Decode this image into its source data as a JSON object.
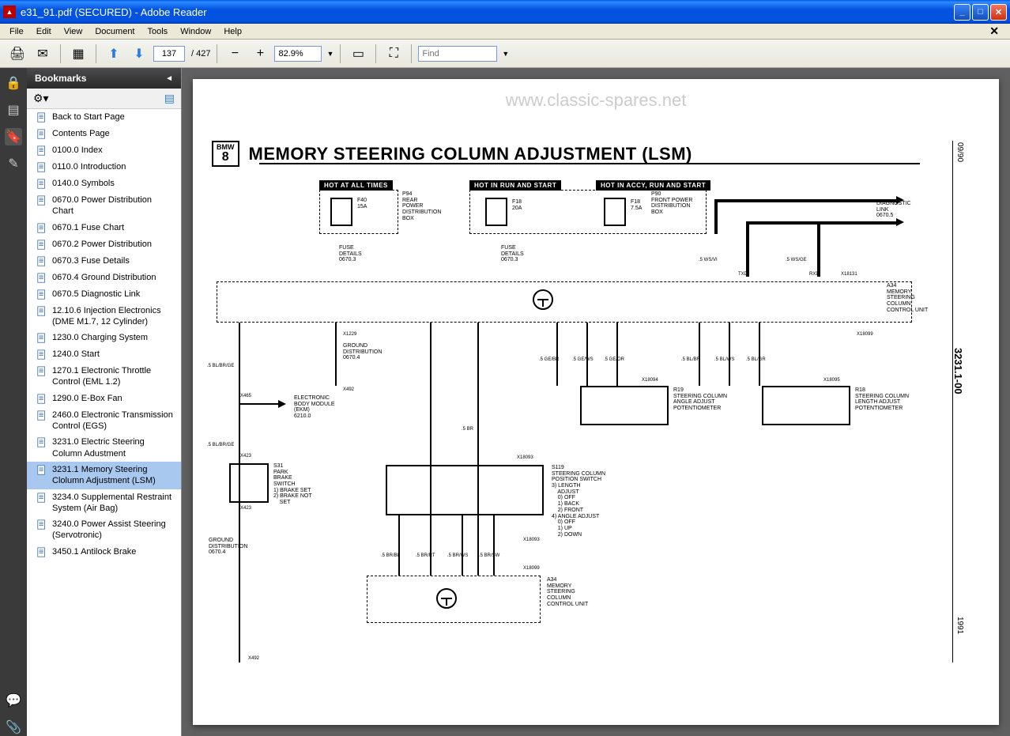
{
  "window": {
    "title": "e31_91.pdf (SECURED) - Adobe Reader"
  },
  "menu": {
    "file": "File",
    "edit": "Edit",
    "view": "View",
    "document": "Document",
    "tools": "Tools",
    "window": "Window",
    "help": "Help"
  },
  "toolbar": {
    "page_current": "137",
    "page_total": "/ 427",
    "zoom": "82.9%",
    "find_placeholder": "Find"
  },
  "bookmarks": {
    "title": "Bookmarks",
    "items": [
      "Back to Start Page",
      "Contents Page",
      "0100.0 Index",
      "0110.0 Introduction",
      "0140.0 Symbols",
      "0670.0 Power Distribution Chart",
      "0670.1 Fuse Chart",
      "0670.2 Power Distribution",
      "0670.3 Fuse Details",
      "0670.4 Ground Distribution",
      "0670.5 Diagnostic Link",
      "12.10.6 Injection Electronics (DME M1.7, 12 Cylinder)",
      "1230.0 Charging System",
      "1240.0 Start",
      "1270.1 Electronic Throttle Control (EML 1.2)",
      "1290.0 E-Box Fan",
      "2460.0 Electronic Transmission Control (EGS)",
      "3231.0 Electric Steering Column Adustment",
      "3231.1 Memory Steering Clolumn Adjustment (LSM)",
      "3234.0 Supplemental Restraint System (Air Bag)",
      "3240.0 Power Assist Steering (Servotronic)",
      "3450.1 Antilock Brake"
    ],
    "selected_index": 18
  },
  "diagram": {
    "watermark": "www.classic-spares.net",
    "badge_top": "BMW",
    "badge_num": "8",
    "title": "MEMORY STEERING COLUMN ADJUSTMENT (LSM)",
    "hot1": "HOT AT ALL TIMES",
    "hot2": "HOT IN RUN AND START",
    "hot3": "HOT IN ACCY, RUN AND START",
    "p94": "P94\nREAR\nPOWER\nDISTRIBUTION\nBOX",
    "f40": "F40\n15A",
    "p90": "P90\nFRONT POWER\nDISTRIBUTION\nBOX",
    "f18a": "F18\n20A",
    "f18b": "F18\n7.5A",
    "fuse_details": "FUSE\nDETAILS\n0670.3",
    "diag_link": "DIAGNOSTIC\nLINK\n0670.5",
    "a34": "A34\nMEMORY\nSTEERING\nCOLUMN\nCONTROL UNIT",
    "ground_dist": "GROUND\nDISTRIBUTION\n0670.4",
    "ebm": "ELECTRONIC\nBODY MODULE\n(EKM)\n6210.0",
    "s31": "S31\nPARK\nBRAKE\nSWITCH\n1) BRAKE SET\n2) BRAKE NOT\n    SET",
    "r19": "R19\nSTEERING COLUMN\nANGLE ADJUST\nPOTENTIOMETER",
    "r18": "R18\nSTEERING COLUMN\nLENGTH ADJUST\nPOTENTIOMETER",
    "s119": "S119\nSTEERING COLUMN\nPOSITION SWITCH\n3) LENGTH\n    ADJUST\n    0) OFF\n    1) BACK\n    2) FRONT\n4) ANGLE ADJUST\n    0) OFF\n    1) UP\n    2) DOWN",
    "a34_bottom": "A34\nMEMORY\nSTEERING\nCOLUMN\nCONTROL UNIT",
    "wires": {
      "blbrge": ".5 BL/BR/GE",
      "wsvi": ".5 WS/VI",
      "wsge": ".5 WS/GE",
      "gebr": ".5 GE/BR",
      "gews": ".5 GE/WS",
      "geor": ".5 GE/OR",
      "blbr": ".5 BL/BR",
      "blws": ".5 BL/WS",
      "blgr": ".5 BL/GR",
      "br": ".5 BR",
      "brbl": ".5 BR/BL",
      "brrt": ".5 BR/RT",
      "brws": ".5 BR/WS",
      "brsw": ".5 BR/SW"
    },
    "connectors": {
      "txd": "TXD",
      "rxd": "RXD",
      "x1229": "X1229",
      "x18131": "X18131",
      "x18099": "X18099",
      "x465": "X465",
      "x492": "X492",
      "x423": "X423",
      "x18093": "X18093",
      "x18094": "X18094",
      "x18095": "X18095"
    },
    "side_date": "09/90",
    "side_ref": "3231.1-00",
    "side_year": "1991"
  }
}
